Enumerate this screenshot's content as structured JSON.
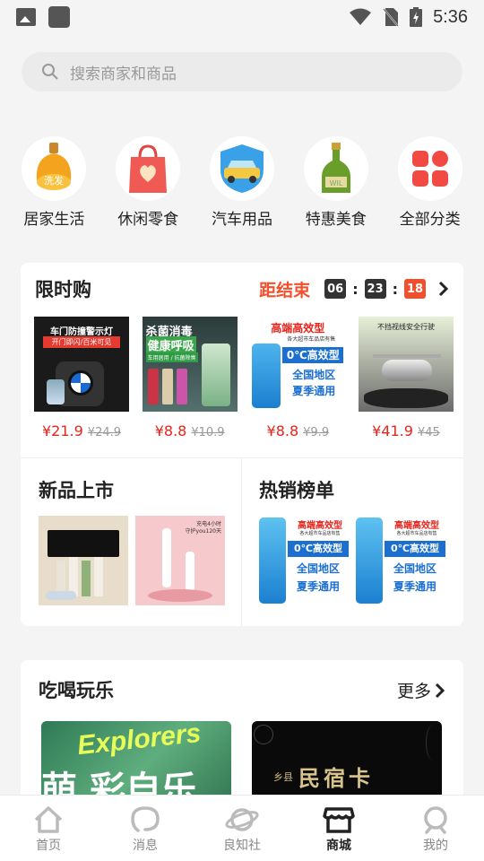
{
  "status_bar": {
    "time": "5:36"
  },
  "search": {
    "placeholder": "搜索商家和商品"
  },
  "categories": [
    {
      "label": "居家生活",
      "icon": "lamp-icon"
    },
    {
      "label": "休闲零食",
      "icon": "shopping-bag-icon"
    },
    {
      "label": "汽车用品",
      "icon": "car-shield-icon"
    },
    {
      "label": "特惠美食",
      "icon": "bottle-icon"
    },
    {
      "label": "全部分类",
      "icon": "grid-icon"
    }
  ],
  "flash_sale": {
    "title": "限时购",
    "countdown_label": "距结束",
    "hours": "06",
    "minutes": "23",
    "seconds": "18",
    "colon": ":",
    "products": [
      {
        "price": "¥21.9",
        "original": "¥24.9",
        "img_line1": "车门防撞警示灯",
        "img_line2": "开门即闪/百米可见"
      },
      {
        "price": "¥8.8",
        "original": "¥10.9",
        "img_line1": "杀菌消毒",
        "img_line2": "健康呼吸",
        "img_line3": "车用居用 / 抗菌除臭"
      },
      {
        "price": "¥8.8",
        "original": "¥9.9",
        "img_line1": "高端高效型",
        "img_line2": "各大超市车品店有售",
        "img_line3": "0℃高效型",
        "img_line4": "全国地区",
        "img_line5": "夏季通用"
      },
      {
        "price": "¥41.9",
        "original": "¥45",
        "img_line1": "不挡视线安全行驶"
      }
    ]
  },
  "new_arrivals": {
    "title": "新品上市",
    "img2_line1": "充电4小时",
    "img2_line2": "守护you120天"
  },
  "hot_list": {
    "title": "热销榜单",
    "img_line1": "高端高效型",
    "img_line2": "各大超市车品店有售",
    "img_line3": "0℃高效型",
    "img_line4": "全国地区",
    "img_line5": "夏季通用"
  },
  "food_fun": {
    "title": "吃喝玩乐",
    "more": "更多",
    "banner1_text": "Explorers",
    "banner1_cn": "萌 彩自乐",
    "banner2_text": "民宿卡",
    "banner2_small": "乡县"
  },
  "tabs": [
    {
      "label": "首页",
      "icon": "home-icon",
      "active": false
    },
    {
      "label": "消息",
      "icon": "message-icon",
      "active": false
    },
    {
      "label": "良知社",
      "icon": "planet-icon",
      "active": false
    },
    {
      "label": "商城",
      "icon": "store-icon",
      "active": true
    },
    {
      "label": "我的",
      "icon": "profile-icon",
      "active": false
    }
  ],
  "colors": {
    "accent_red": "#e8231a",
    "countdown_red": "#f2502c",
    "countdown_dark": "#333333"
  }
}
